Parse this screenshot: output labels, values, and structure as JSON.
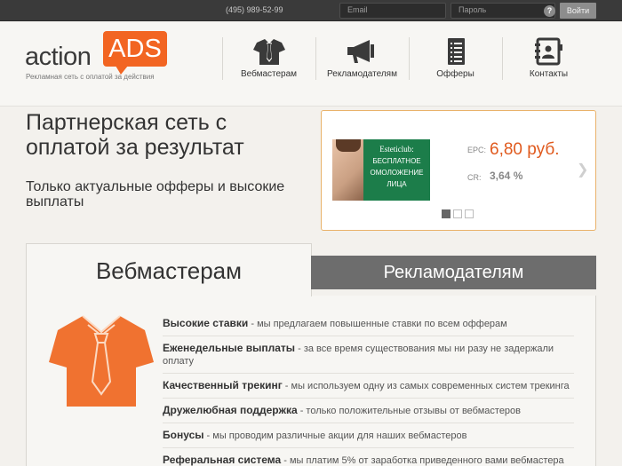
{
  "topbar": {
    "phone": "(495) 989-52-99",
    "email_placeholder": "Email",
    "password_placeholder": "Пароль",
    "help": "?",
    "login": "Войти"
  },
  "logo": {
    "word": "action",
    "ads": "ADS",
    "tagline": "Рекламная сеть с оплатой за действия"
  },
  "nav": [
    {
      "label": "Вебмастерам",
      "icon": "shirt-icon"
    },
    {
      "label": "Рекламодателям",
      "icon": "megaphone-icon"
    },
    {
      "label": "Офферы",
      "icon": "list-icon"
    },
    {
      "label": "Контакты",
      "icon": "address-book-icon"
    }
  ],
  "hero": {
    "title": "Партнерская сеть с оплатой за результат",
    "subtitle": "Только актуальные офферы и высокие выплаты"
  },
  "promo": {
    "brand": "Esteticlub:",
    "ad_text": "БЕСПЛАТНОЕ ОМОЛОЖЕНИЕ ЛИЦА",
    "epc_label": "EPC:",
    "epc_value": "6,80 руб.",
    "cr_label": "CR:",
    "cr_value": "3,64 %",
    "slides": 3,
    "active_slide": 1
  },
  "tabs": {
    "active": "Вебмастерам",
    "inactive": "Рекламодателям"
  },
  "features": [
    {
      "title": "Высокие ставки",
      "text": " - мы предлагаем повышенные ставки по всем офферам"
    },
    {
      "title": "Еженедельные выплаты",
      "text": " - за все время существования мы ни разу не задержали оплату"
    },
    {
      "title": "Качественный трекинг",
      "text": " - мы используем одну из самых современных систем трекинга"
    },
    {
      "title": "Дружелюбная поддержка",
      "text": " - только положительные отзывы от вебмастеров"
    },
    {
      "title": "Бонусы",
      "text": " - мы проводим различные акции для наших вебмастеров"
    },
    {
      "title": "Реферальная система",
      "text": " - мы платим 5% от заработка приведенного вами вебмастера"
    }
  ],
  "colors": {
    "accent": "#f26522",
    "topbar": "#3a3a3a",
    "tab_inactive": "#6d6d6d",
    "ad_green": "#1c7d4a"
  }
}
